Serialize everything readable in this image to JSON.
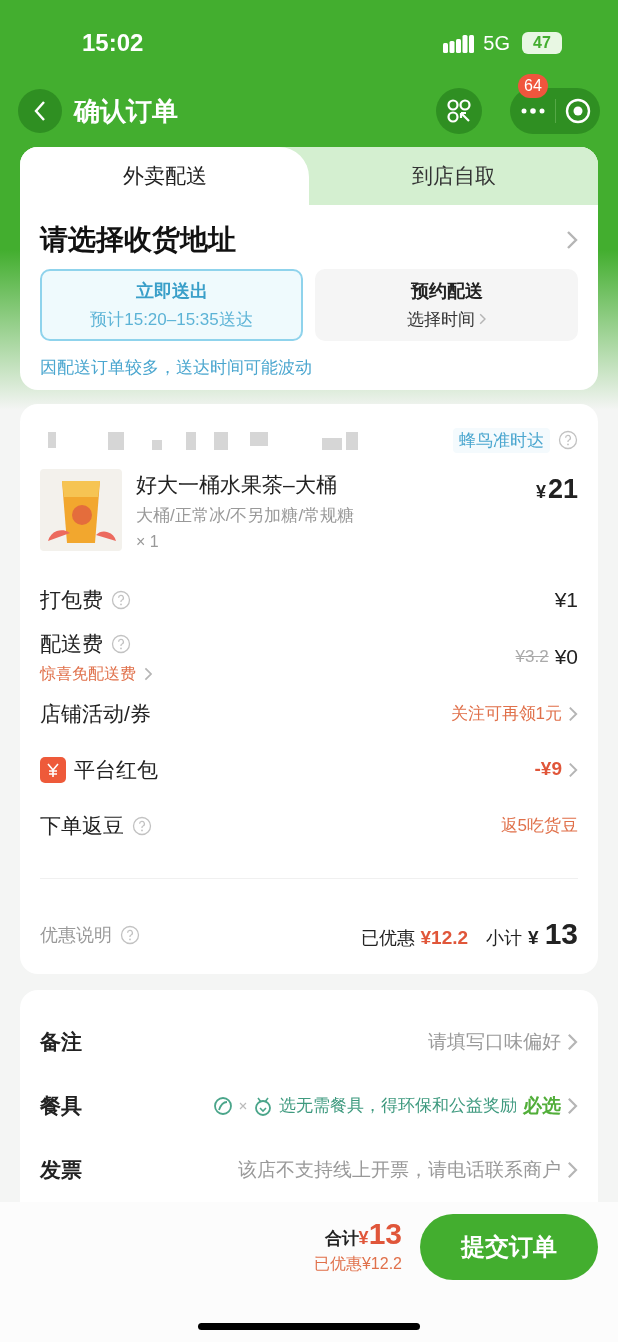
{
  "status_bar": {
    "time": "15:02",
    "network": "5G",
    "battery": "47"
  },
  "nav": {
    "title": "确认订单",
    "badge": "64"
  },
  "delivery_tabs": [
    {
      "label": "外卖配送",
      "selected": true
    },
    {
      "label": "到店自取",
      "selected": false
    }
  ],
  "address_prompt": "请选择收货地址",
  "delivery_options": [
    {
      "title": "立即送出",
      "subtitle": "预计15:20–15:35送达",
      "selected": true
    },
    {
      "title": "预约配送",
      "subtitle": "选择时间",
      "selected": false
    }
  ],
  "delivery_notice": "因配送订单较多，送达时间可能波动",
  "store": {
    "tag": "蜂鸟准时达"
  },
  "item": {
    "name": "好大一桶水果茶–大桶",
    "specs": "大桶/正常冰/不另加糖/常规糖",
    "quantity": "× 1",
    "currency": "¥",
    "price": "21"
  },
  "fee_rows": [
    {
      "kind": "fee",
      "label": "打包费",
      "help": true,
      "value": "¥1",
      "chevron": false
    },
    {
      "kind": "fee",
      "label": "配送费",
      "help": true,
      "note": "惊喜免配送费",
      "strike": "¥3.2",
      "value": "¥0",
      "chevron": false
    },
    {
      "kind": "promo",
      "label": "店铺活动/券",
      "help": false,
      "value": "关注可再领1元",
      "chevron": true
    },
    {
      "kind": "redpacket",
      "label": "平台红包",
      "help": false,
      "value": "-¥9",
      "chevron": true
    },
    {
      "kind": "promo",
      "label": "下单返豆",
      "help": true,
      "value": "返5吃货豆",
      "chevron": false
    }
  ],
  "summary": {
    "label": "优惠说明",
    "saved_label": "已优惠",
    "saved": "¥12.2",
    "subtotal_label": "小计",
    "currency": "¥",
    "subtotal": "13"
  },
  "extras": [
    {
      "kind": "remark",
      "label": "备注",
      "placeholder": "请填写口味偏好"
    },
    {
      "kind": "cutlery",
      "label": "餐具",
      "value": "选无需餐具，得环保和公益奖励",
      "required": "必选"
    },
    {
      "kind": "invoice",
      "label": "发票",
      "value": "该店不支持线上开票，请电话联系商户"
    }
  ],
  "footer": {
    "total_label": "合计",
    "currency": "¥",
    "total": "13",
    "saved": "已优惠¥12.2",
    "submit": "提交订单"
  }
}
